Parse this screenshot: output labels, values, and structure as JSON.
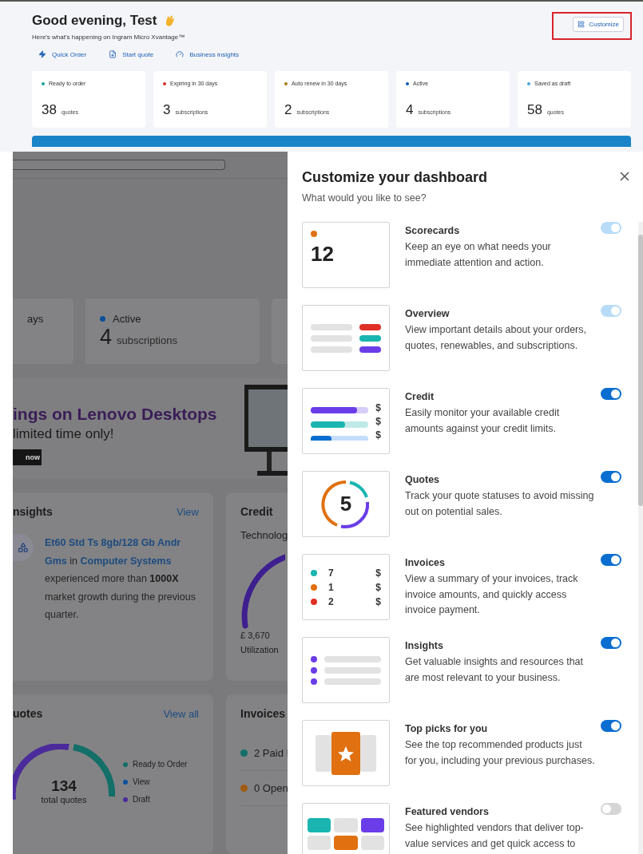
{
  "header": {
    "greeting": "Good evening, Test",
    "subtitle": "Here's what's happening on Ingram Micro Xvantage™",
    "customize_button": "Customize",
    "quick_links": [
      {
        "kind": "order",
        "label": "Quick Order"
      },
      {
        "kind": "quote",
        "label": "Start quote"
      },
      {
        "kind": "insights",
        "label": "Business insights"
      }
    ],
    "scorecards": [
      {
        "label": "Ready to order",
        "value": "38",
        "unit": "quotes",
        "color": "#1aa39a"
      },
      {
        "label": "Expiring in 30 days",
        "value": "3",
        "unit": "subscriptions",
        "color": "#d9302c"
      },
      {
        "label": "Auto renew in 30 days",
        "value": "2",
        "unit": "subscriptions",
        "color": "#a87b14"
      },
      {
        "label": "Active",
        "value": "4",
        "unit": "subscriptions",
        "color": "#0b5db8"
      },
      {
        "label": "Saved as draft",
        "value": "58",
        "unit": "quotes",
        "color": "#4aa3df"
      }
    ]
  },
  "dashboard_behind": {
    "scorecards": [
      {
        "label": "ays"
      },
      {
        "label": "Active",
        "value": "4",
        "unit": "subscriptions",
        "color": "#0b4f9a"
      }
    ],
    "banner": {
      "headline": "ings on Lenovo Desktops",
      "tagline": "limited time only!",
      "button": "now"
    },
    "insights": {
      "title": "nsights",
      "link": "View",
      "segments": [
        {
          "kind": "link",
          "text": "Et60 Std Ts 8gb/128 Gb Andr Gms"
        },
        {
          "kind": "plain",
          "text": "in"
        },
        {
          "kind": "link",
          "text": "Computer Systems"
        },
        {
          "kind": "plain",
          "text": "experienced more than"
        },
        {
          "kind": "bold",
          "text": "1000X"
        },
        {
          "kind": "plain",
          "text": "market growth during the previous quarter."
        }
      ]
    },
    "credit": {
      "title": "Credit",
      "subtitle": "Technolog",
      "amount": "£ 3,670",
      "caption": "Utilization"
    },
    "quotes": {
      "title": "uotes",
      "link": "View all",
      "total": "134",
      "total_label": "total quotes",
      "legend": [
        {
          "label": "Ready to Order",
          "color": "#136f68"
        },
        {
          "label": "View",
          "color": "#0b4f9a"
        },
        {
          "label": "Draft",
          "color": "#4b2b9c"
        }
      ]
    },
    "invoices": {
      "title": "Invoices",
      "rows": [
        {
          "label": "2 Paid I",
          "color": "#136f68"
        },
        {
          "label": "0 Open",
          "color": "#a05a12"
        }
      ]
    }
  },
  "panel": {
    "title": "Customize your dashboard",
    "subtitle": "What would you like to see?",
    "widgets": [
      {
        "kind": "scorecards",
        "title": "Scorecards",
        "description": "Keep an eye on what needs your immediate attention and action.",
        "on": true,
        "disabled": true,
        "preview_value": "12"
      },
      {
        "kind": "overview",
        "title": "Overview",
        "description": "View important details about your orders, quotes, renewables, and subscriptions.",
        "on": true,
        "disabled": true
      },
      {
        "kind": "credit",
        "title": "Credit",
        "description": "Easily monitor your available credit amounts against your credit limits.",
        "on": true,
        "disabled": false,
        "preview_symbols": [
          "$",
          "$",
          "$"
        ]
      },
      {
        "kind": "quotes",
        "title": "Quotes",
        "description": "Track your quote statuses to avoid missing out on potential sales.",
        "on": true,
        "disabled": false,
        "preview_value": "5"
      },
      {
        "kind": "invoices",
        "title": "Invoices",
        "description": "View a summary of your invoices, track invoice amounts, and quickly access invoice payment.",
        "on": true,
        "disabled": false,
        "preview_rows": [
          {
            "count": "7",
            "symbol": "$",
            "color": "#1ab5b0"
          },
          {
            "count": "1",
            "symbol": "$",
            "color": "#e07010"
          },
          {
            "count": "2",
            "symbol": "$",
            "color": "#e03025"
          }
        ]
      },
      {
        "kind": "insights",
        "title": "Insights",
        "description": "Get valuable insights and resources that are most relevant to your business.",
        "on": true,
        "disabled": false
      },
      {
        "kind": "top_picks",
        "title": "Top picks for you",
        "description": "See the top recommended products just for you, including your previous purchases.",
        "on": true,
        "disabled": false
      },
      {
        "kind": "vendors",
        "title": "Featured vendors",
        "description": "See highlighted vendors that deliver top-value services and get quick access to",
        "on": false,
        "disabled": false
      }
    ]
  }
}
